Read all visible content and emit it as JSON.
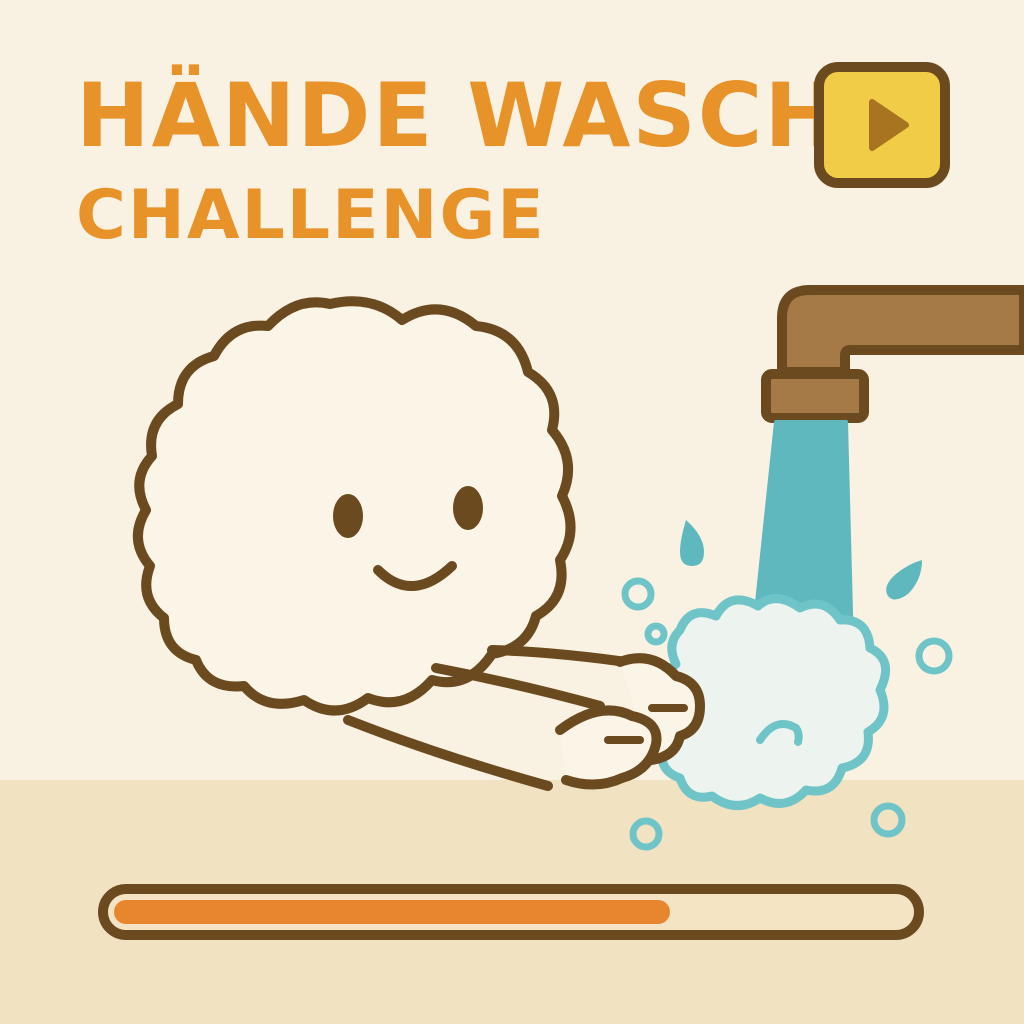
{
  "title": {
    "line1": "HÄNDE WASCH",
    "line2": "CHALLENGE"
  },
  "play_button": {
    "icon": "play-icon",
    "color": "#f1cd47"
  },
  "scene": {
    "character": "smiling-foam-bubble",
    "faucet": "faucet-icon",
    "water_color": "#5fb8bd",
    "foam_color": "#6fc4c7"
  },
  "progress": {
    "value": 0.7,
    "fill_color": "#e8852f",
    "track_color": "#f4e4c4"
  },
  "colors": {
    "title": "#e8922a",
    "outline": "#6b4a1f",
    "background": "#f9f2e2",
    "floor": "#f1e2c2"
  }
}
